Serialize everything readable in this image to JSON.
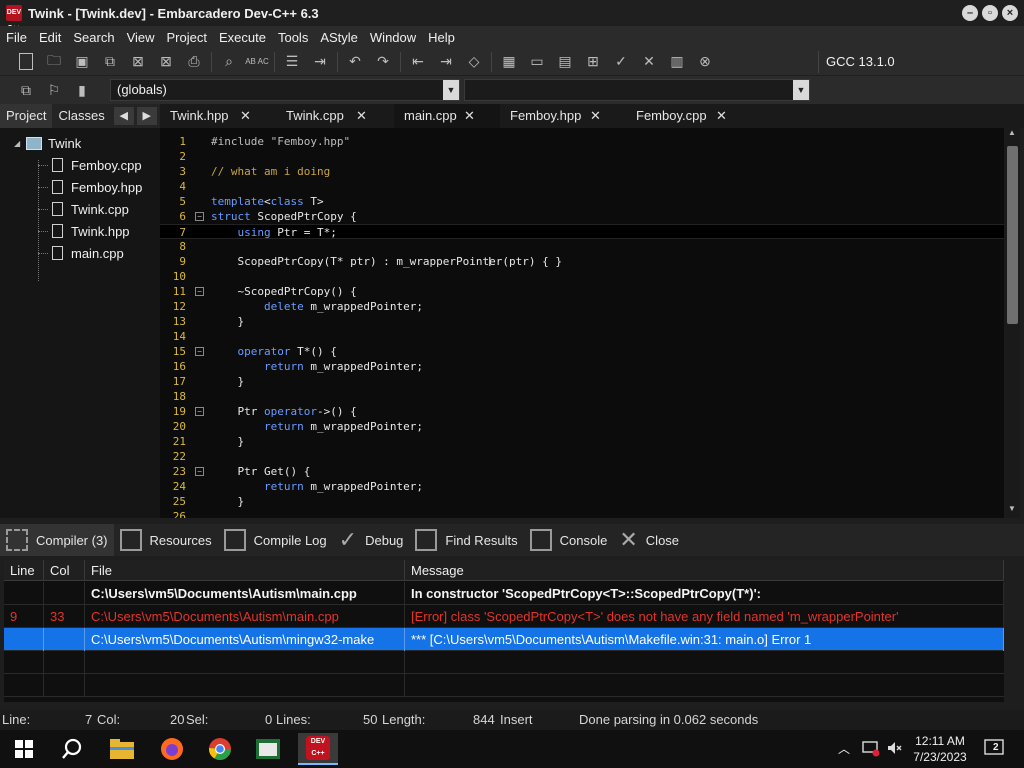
{
  "window": {
    "title": "Twink - [Twink.dev] - Embarcadero Dev-C++ 6.3",
    "app_icon_text": "DEV C++"
  },
  "menu": [
    "File",
    "Edit",
    "Search",
    "View",
    "Project",
    "Execute",
    "Tools",
    "AStyle",
    "Window",
    "Help"
  ],
  "toolbar": {
    "compiler": "GCC 13.1.0",
    "scope_combo": "(globals)",
    "function_combo": ""
  },
  "project_panel": {
    "tabs": [
      "Project",
      "Classes"
    ],
    "root": "Twink",
    "files": [
      "Femboy.cpp",
      "Femboy.hpp",
      "Twink.cpp",
      "Twink.hpp",
      "main.cpp"
    ]
  },
  "editor": {
    "tabs": [
      {
        "label": "Twink.hpp",
        "active": false
      },
      {
        "label": "Twink.cpp",
        "active": false
      },
      {
        "label": "main.cpp",
        "active": true
      },
      {
        "label": "Femboy.hpp",
        "active": false
      },
      {
        "label": "Femboy.cpp",
        "active": false
      }
    ],
    "current_line": 7,
    "lines": [
      {
        "n": "1",
        "code": "#include \"Femboy.hpp\""
      },
      {
        "n": "2",
        "code": ""
      },
      {
        "n": "3",
        "code": "// what am i doing"
      },
      {
        "n": "4",
        "code": ""
      },
      {
        "n": "5",
        "code": "template<class T>"
      },
      {
        "n": "6",
        "code": "struct ScopedPtrCopy {"
      },
      {
        "n": "7",
        "code": "    using Ptr = T*;"
      },
      {
        "n": "8",
        "code": ""
      },
      {
        "n": "9",
        "code": "    ScopedPtrCopy(T* ptr) : m_wrapperPointer(ptr) { }"
      },
      {
        "n": "10",
        "code": ""
      },
      {
        "n": "11",
        "code": "    ~ScopedPtrCopy() {"
      },
      {
        "n": "12",
        "code": "        delete m_wrappedPointer;"
      },
      {
        "n": "13",
        "code": "    }"
      },
      {
        "n": "14",
        "code": ""
      },
      {
        "n": "15",
        "code": "    operator T*() {"
      },
      {
        "n": "16",
        "code": "        return m_wrappedPointer;"
      },
      {
        "n": "17",
        "code": "    }"
      },
      {
        "n": "18",
        "code": ""
      },
      {
        "n": "19",
        "code": "    Ptr operator->() {"
      },
      {
        "n": "20",
        "code": "        return m_wrappedPointer;"
      },
      {
        "n": "21",
        "code": "    }"
      },
      {
        "n": "22",
        "code": ""
      },
      {
        "n": "23",
        "code": "    Ptr Get() {"
      },
      {
        "n": "24",
        "code": "        return m_wrappedPointer;"
      },
      {
        "n": "25",
        "code": "    }"
      },
      {
        "n": "26",
        "code": ""
      }
    ]
  },
  "bottom_tabs": [
    "Compiler (3)",
    "Resources",
    "Compile Log",
    "Debug",
    "Find Results",
    "Console",
    "Close"
  ],
  "messages": {
    "columns": [
      "Line",
      "Col",
      "File",
      "Message"
    ],
    "rows": [
      {
        "line": "",
        "col": "",
        "file": "C:\\Users\\vm5\\Documents\\Autism\\main.cpp",
        "message": "In constructor 'ScopedPtrCopy<T>::ScopedPtrCopy(T*)':",
        "kind": "bold"
      },
      {
        "line": "9",
        "col": "33",
        "file": "C:\\Users\\vm5\\Documents\\Autism\\main.cpp",
        "message": "[Error] class 'ScopedPtrCopy<T>' does not have any field named 'm_wrapperPointer'",
        "kind": "error"
      },
      {
        "line": "",
        "col": "",
        "file": "C:\\Users\\vm5\\Documents\\Autism\\mingw32-make",
        "message": "*** [C:\\Users\\vm5\\Documents\\Autism\\Makefile.win:31: main.o] Error 1",
        "kind": "selected"
      }
    ]
  },
  "status": {
    "line_label": "Line:",
    "line_value": "7",
    "col_label": "Col:",
    "col_value": "20",
    "sel_label": "Sel:",
    "sel_value": "0",
    "lines_label": "Lines:",
    "lines_value": "50",
    "length_label": "Length:",
    "length_value": "844",
    "mode": "Insert",
    "message": "Done parsing in 0.062 seconds"
  },
  "taskbar": {
    "time": "12:11 AM",
    "date": "7/23/2023",
    "notifications": "2",
    "devcpp_label": "DEV C++"
  }
}
